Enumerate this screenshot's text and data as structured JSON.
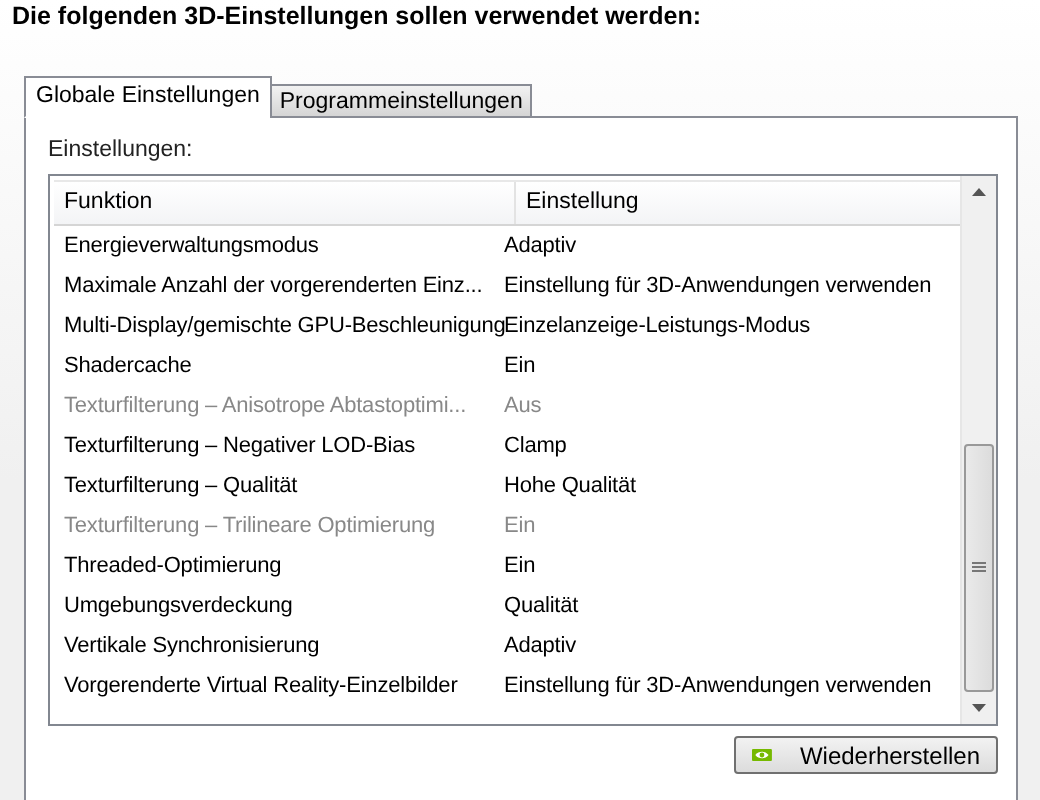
{
  "heading": "Die folgenden 3D-Einstellungen sollen verwendet werden:",
  "tabs": [
    {
      "label": "Globale Einstellungen",
      "selected": true
    },
    {
      "label": "Programmeinstellungen",
      "selected": false
    }
  ],
  "settings_label": "Einstellungen:",
  "table": {
    "columns": [
      "Funktion",
      "Einstellung"
    ],
    "rows": [
      {
        "function": "Energieverwaltungsmodus",
        "value": "Adaptiv",
        "disabled": false
      },
      {
        "function": "Maximale Anzahl der vorgerenderten Einz...",
        "value": "Einstellung für 3D-Anwendungen verwenden",
        "disabled": false
      },
      {
        "function": "Multi-Display/gemischte GPU-Beschleunigung",
        "value": "Einzelanzeige-Leistungs-Modus",
        "disabled": false
      },
      {
        "function": "Shadercache",
        "value": "Ein",
        "disabled": false
      },
      {
        "function": "Texturfilterung – Anisotrope Abtastoptimi...",
        "value": "Aus",
        "disabled": true
      },
      {
        "function": "Texturfilterung – Negativer LOD-Bias",
        "value": "Clamp",
        "disabled": false
      },
      {
        "function": "Texturfilterung – Qualität",
        "value": "Hohe Qualität",
        "disabled": false
      },
      {
        "function": "Texturfilterung – Trilineare Optimierung",
        "value": "Ein",
        "disabled": true
      },
      {
        "function": "Threaded-Optimierung",
        "value": "Ein",
        "disabled": false
      },
      {
        "function": "Umgebungsverdeckung",
        "value": "Qualität",
        "disabled": false
      },
      {
        "function": "Vertikale Synchronisierung",
        "value": "Adaptiv",
        "disabled": false
      },
      {
        "function": "Vorgerenderte Virtual Reality-Einzelbilder",
        "value": "Einstellung für 3D-Anwendungen verwenden",
        "disabled": false
      }
    ]
  },
  "restore_button": "Wiederherstellen"
}
